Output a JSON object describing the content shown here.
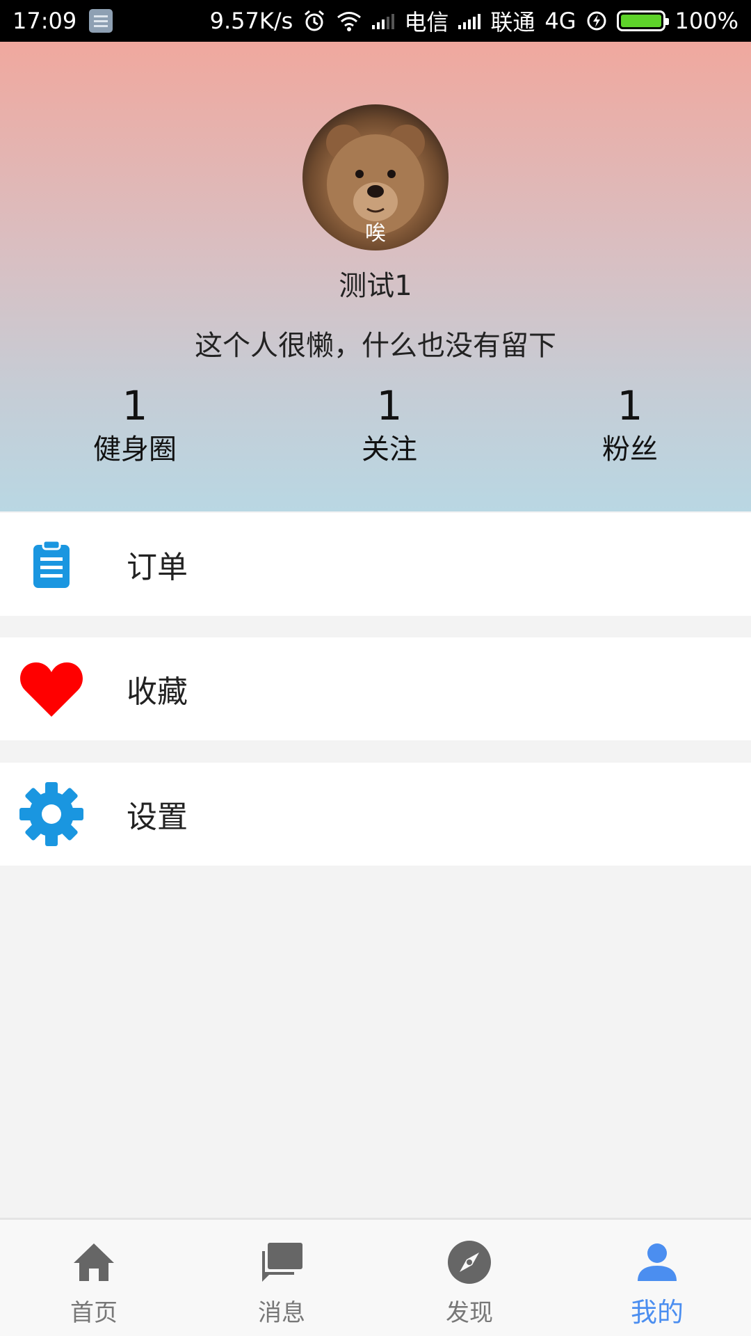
{
  "status_bar": {
    "time": "17:09",
    "speed": "9.57K/s",
    "carrier1": "电信",
    "carrier2": "联通",
    "network": "4G",
    "battery": "100%"
  },
  "profile": {
    "avatar_caption": "唉",
    "username": "测试1",
    "bio": "这个人很懒，什么也没有留下",
    "stats": [
      {
        "value": "1",
        "label": "健身圈"
      },
      {
        "value": "1",
        "label": "关注"
      },
      {
        "value": "1",
        "label": "粉丝"
      }
    ]
  },
  "menu": [
    {
      "label": "订单",
      "icon": "clipboard-icon",
      "color": "#1a96e0"
    },
    {
      "label": "收藏",
      "icon": "heart-icon",
      "color": "#ff0000"
    },
    {
      "label": "设置",
      "icon": "gear-icon",
      "color": "#1a96e0"
    }
  ],
  "bottom_nav": [
    {
      "label": "首页",
      "icon": "home-icon"
    },
    {
      "label": "消息",
      "icon": "chat-icon"
    },
    {
      "label": "发现",
      "icon": "compass-icon"
    },
    {
      "label": "我的",
      "icon": "person-icon",
      "active": true
    }
  ],
  "colors": {
    "accent": "#4b8ef0",
    "icon_inactive": "#666666"
  }
}
